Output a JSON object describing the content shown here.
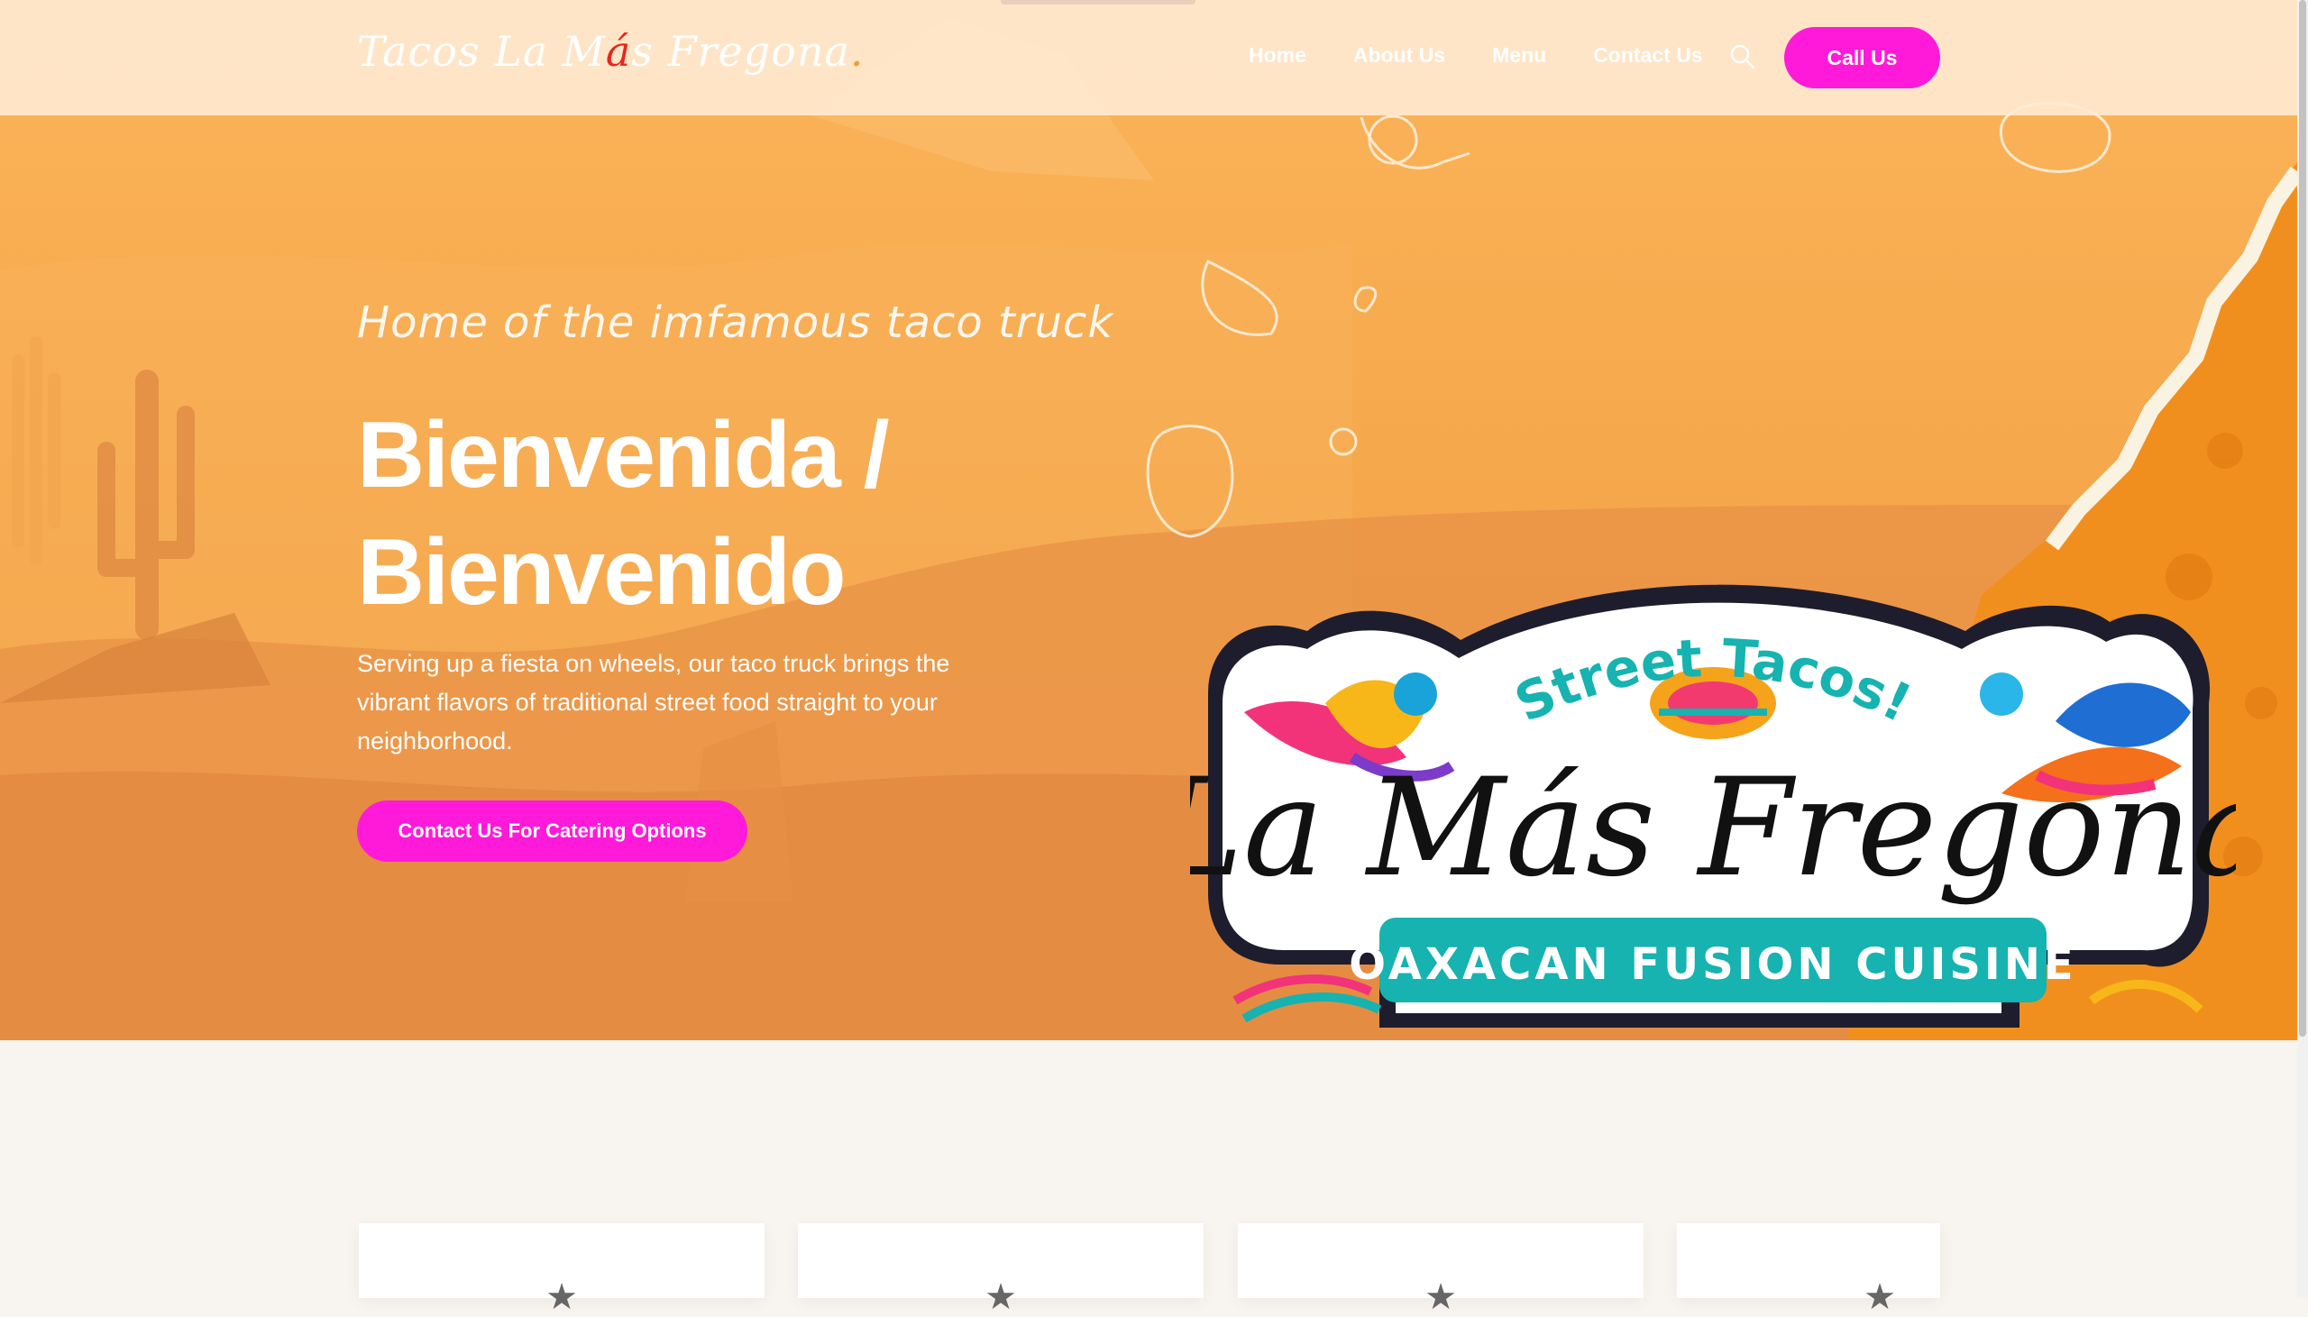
{
  "header": {
    "logo": {
      "part1": "Tacos La M",
      "accent": "á",
      "part2": "s Fregona",
      "dot": "."
    },
    "nav": [
      "Home",
      "About Us",
      "Menu",
      "Contact Us"
    ],
    "call_label": "Call Us",
    "search_icon": "search-icon"
  },
  "hero": {
    "tagline": "Home of the imfamous taco truck",
    "title_line1": "Bienvenida /",
    "title_line2": "Bienvenido",
    "description": "Serving up a fiesta on wheels, our taco truck brings the vibrant flavors of traditional street food straight to your neighborhood.",
    "cta_label": "Contact Us For Catering Options"
  },
  "badge": {
    "top_text": "Street Tacos!",
    "name": "La Más Fregona",
    "subtitle": "OAXACAN FUSION CUISINE"
  },
  "cards": [
    {
      "icon": "star-icon"
    },
    {
      "icon": "star-icon"
    },
    {
      "icon": "star-icon"
    },
    {
      "icon": "star-icon"
    }
  ],
  "colors": {
    "accent_pink": "#ff1ad9",
    "hero_orange": "#f7a94d",
    "teal": "#16b3b0"
  }
}
